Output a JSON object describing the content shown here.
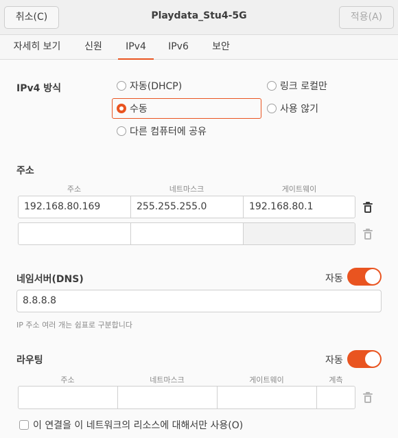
{
  "header": {
    "cancel_label": "취소(C)",
    "title": "Playdata_Stu4-5G",
    "apply_label": "적용(A)"
  },
  "tabs": [
    {
      "label": "자세히 보기",
      "active": false
    },
    {
      "label": "신원",
      "active": false
    },
    {
      "label": "IPv4",
      "active": true
    },
    {
      "label": "IPv6",
      "active": false
    },
    {
      "label": "보안",
      "active": false
    }
  ],
  "ipv4_method": {
    "title": "IPv4 방식",
    "options": [
      {
        "label": "자동(DHCP)",
        "checked": false
      },
      {
        "label": "링크 로컬만",
        "checked": false
      },
      {
        "label": "수동",
        "checked": true
      },
      {
        "label": "사용 않기",
        "checked": false
      },
      {
        "label": "다른 컴퓨터에 공유",
        "checked": false
      }
    ]
  },
  "addresses": {
    "title": "주소",
    "columns": [
      "주소",
      "네트마스크",
      "게이트웨이"
    ],
    "rows": [
      [
        "192.168.80.169",
        "255.255.255.0",
        "192.168.80.1"
      ],
      [
        "",
        "",
        ""
      ]
    ]
  },
  "dns": {
    "title": "네임서버(DNS)",
    "auto_label": "자동",
    "auto_on": true,
    "value": "8.8.8.8",
    "hint": "IP 주소 여러 개는 쉼표로 구분합니다"
  },
  "routing": {
    "title": "라우팅",
    "auto_label": "자동",
    "auto_on": true,
    "columns": [
      "주소",
      "네트마스크",
      "게이트웨이",
      "계측"
    ],
    "rows": [
      [
        "",
        "",
        "",
        ""
      ]
    ]
  },
  "only_local_resources": {
    "label": "이 연결을 이 네트워크의 리소스에 대해서만 사용(O)",
    "checked": false
  },
  "colors": {
    "accent": "#e95420"
  },
  "icons": {
    "delete": "trash-icon"
  }
}
